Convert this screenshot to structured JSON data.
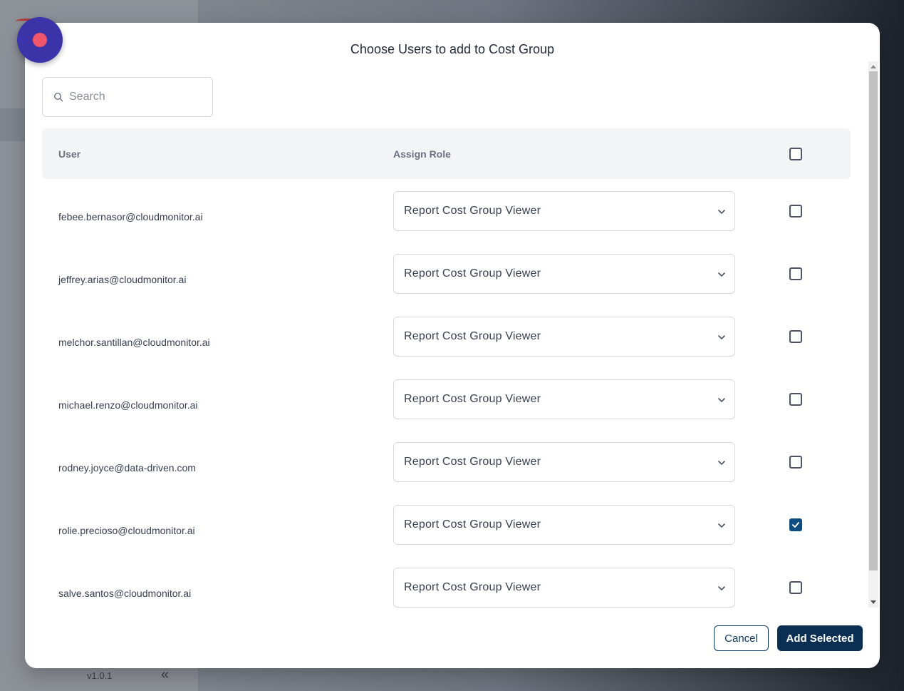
{
  "background": {
    "version": "v1.0.1",
    "collapse_glyph": "«"
  },
  "modal": {
    "title": "Choose Users to add to Cost Group",
    "search": {
      "placeholder": "Search",
      "value": ""
    },
    "table": {
      "headers": {
        "user": "User",
        "role": "Assign Role"
      },
      "select_all_checked": false,
      "rows": [
        {
          "email": "febee.bernasor@cloudmonitor.ai",
          "role": "Report Cost Group Viewer",
          "checked": false
        },
        {
          "email": "jeffrey.arias@cloudmonitor.ai",
          "role": "Report Cost Group Viewer",
          "checked": false
        },
        {
          "email": "melchor.santillan@cloudmonitor.ai",
          "role": "Report Cost Group Viewer",
          "checked": false
        },
        {
          "email": "michael.renzo@cloudmonitor.ai",
          "role": "Report Cost Group Viewer",
          "checked": false
        },
        {
          "email": "rodney.joyce@data-driven.com",
          "role": "Report Cost Group Viewer",
          "checked": false
        },
        {
          "email": "rolie.precioso@cloudmonitor.ai",
          "role": "Report Cost Group Viewer",
          "checked": true
        },
        {
          "email": "salve.santos@cloudmonitor.ai",
          "role": "Report Cost Group Viewer",
          "checked": false
        }
      ]
    },
    "buttons": {
      "cancel": "Cancel",
      "add_selected": "Add Selected"
    }
  },
  "colors": {
    "primary": "#0b2f52",
    "checkbox_checked": "#0f4c81",
    "fab": "#3b33a8",
    "fab_dot": "#f0566b"
  },
  "icons": {
    "search": "search-icon",
    "chevron": "chevron-down-icon",
    "check": "check-icon",
    "record": "record-icon"
  }
}
